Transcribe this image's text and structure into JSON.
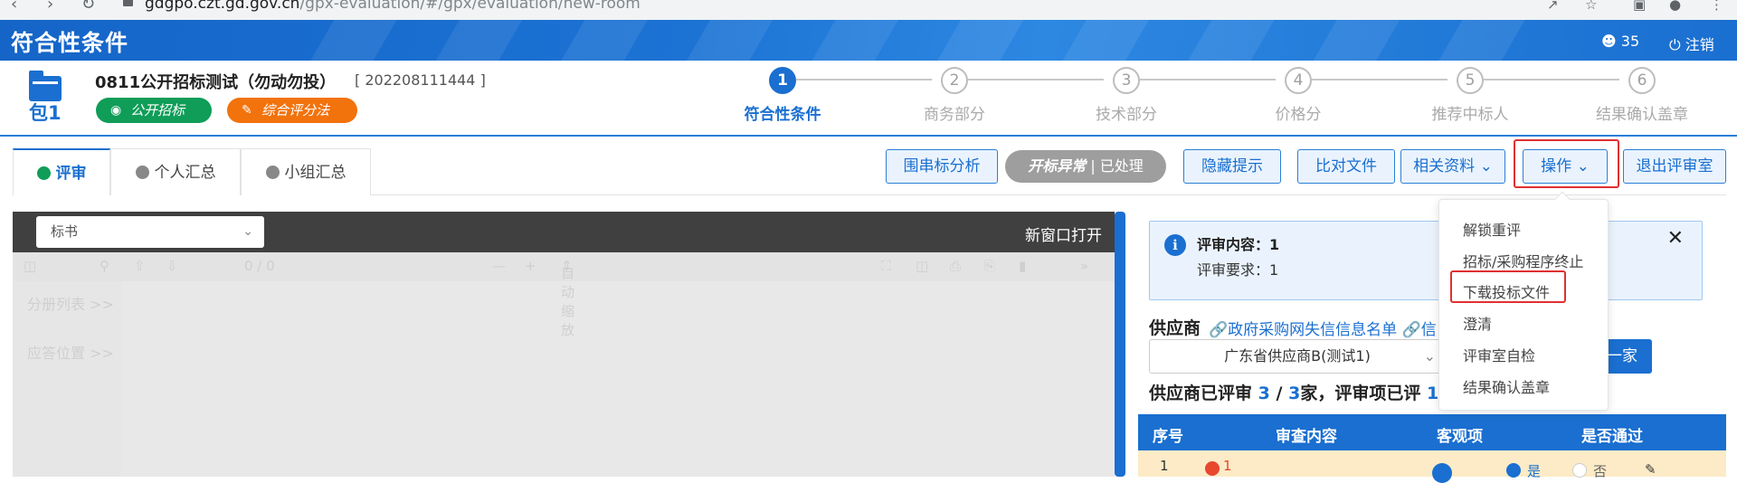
{
  "browser": {
    "url_host": "gdgpo.czt.gd.gov.cn",
    "url_path": "/gpx-evaluation/#/gpx/evaluation/new-room"
  },
  "header": {
    "title": "符合性条件",
    "user_count": "35",
    "logout_label": "注销"
  },
  "project": {
    "package_label": "包1",
    "name": "0811公开招标测试（勿动勿投）",
    "code": "[ 202208111444 ]",
    "tag_method": "公开招标",
    "tag_scoring": "综合评分法"
  },
  "steps": [
    {
      "num": "1",
      "label": "符合性条件"
    },
    {
      "num": "2",
      "label": "商务部分"
    },
    {
      "num": "3",
      "label": "技术部分"
    },
    {
      "num": "4",
      "label": "价格分"
    },
    {
      "num": "5",
      "label": "推荐中标人"
    },
    {
      "num": "6",
      "label": "结果确认盖章"
    }
  ],
  "tabs": [
    {
      "label": "评审"
    },
    {
      "label": "个人汇总"
    },
    {
      "label": "小组汇总"
    }
  ],
  "toolbar": {
    "bid_analysis": "围串标分析",
    "exception_bold": "开标异常",
    "exception_status": "| 已处理",
    "hide_tips": "隐藏提示",
    "compare_files": "比对文件",
    "related_docs": "相关资料",
    "operations": "操作",
    "exit_room": "退出评审室"
  },
  "viewer": {
    "doc_select": "标书",
    "open_new_window": "新窗口打开",
    "page_info": "0 / 0",
    "zoom": "自动缩放",
    "side_items": [
      "分册列表",
      "应答位置"
    ]
  },
  "review": {
    "content_label": "评审内容：",
    "content_value": "1",
    "req_label": "评审要求：",
    "req_value": "1"
  },
  "supplier": {
    "label": "供应商",
    "link1": "政府采购网失信信息名单",
    "link2": "信",
    "selected": "广东省供应商B(测试1)",
    "next_btn": "一家",
    "progress_prefix": "供应商已评审",
    "progress_done": "3",
    "progress_sep": "/",
    "progress_total": "3",
    "progress_mid": "家，评审项已评",
    "progress_item": "1"
  },
  "table": {
    "headers": [
      "序号",
      "审查内容",
      "客观项",
      "是否通过"
    ],
    "row": {
      "no": "1",
      "flag": "1",
      "yes": "是",
      "no_opt": "否"
    }
  },
  "menu": {
    "items": [
      "解锁重评",
      "招标/采购程序终止",
      "下载投标文件",
      "澄清",
      "评审室自检",
      "结果确认盖章"
    ]
  }
}
